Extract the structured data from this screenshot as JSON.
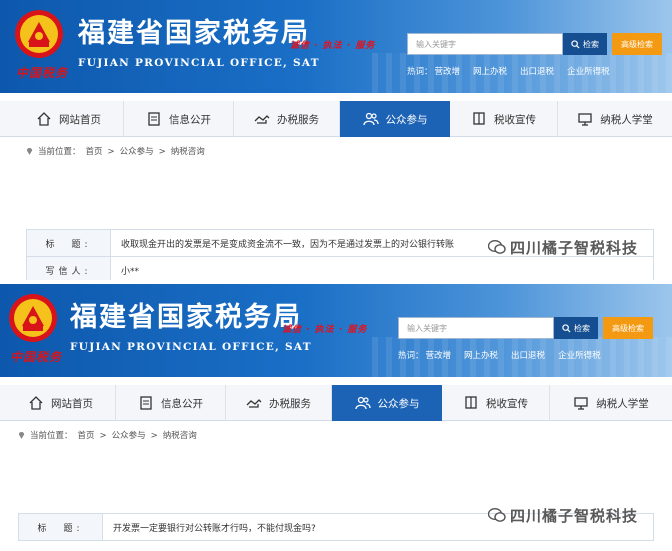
{
  "header": {
    "title_cn": "福建省国家税务局",
    "title_en": "FUJIAN PROVINCIAL OFFICE, SAT",
    "seal_text": "中国税务",
    "slogan": "诚信 · 执法 · 服务",
    "search_placeholder": "输入关键字",
    "search_label": "检索",
    "advanced_search_label": "高级检索",
    "hot_label": "热词：",
    "hot_words": [
      "营改增",
      "网上办税",
      "出口退税",
      "企业所得税"
    ]
  },
  "nav": {
    "items": [
      {
        "label": "网站首页",
        "icon": "home-icon"
      },
      {
        "label": "信息公开",
        "icon": "document-icon"
      },
      {
        "label": "办税服务",
        "icon": "handshake-icon"
      },
      {
        "label": "公众参与",
        "icon": "people-icon",
        "active": true
      },
      {
        "label": "税收宣传",
        "icon": "flag-icon"
      },
      {
        "label": "纳税人学堂",
        "icon": "monitor-icon"
      }
    ]
  },
  "breadcrumb": {
    "prefix": "当前位置：",
    "items": [
      "首页",
      ">",
      "公众参与",
      ">",
      "纳税咨询"
    ]
  },
  "screens": [
    {
      "rows": [
        {
          "key": "标　题:",
          "value": "收取现金开出的发票是不是变成资金流不一致，因为不是通过发票上的对公银行转账"
        },
        {
          "key": "写信人:",
          "value": "小**"
        }
      ]
    },
    {
      "rows": [
        {
          "key": "标　题:",
          "value": "开发票一定要银行对公转账才行吗，不能付现金吗?"
        }
      ]
    }
  ],
  "watermark": {
    "text": "四川橘子智税科技",
    "icon": "wechat-icon"
  },
  "colors": {
    "header_blue": "#0d58ad",
    "nav_active": "#1c62b5",
    "advanced_btn": "#f39a12",
    "seal_red": "#d8141a"
  }
}
